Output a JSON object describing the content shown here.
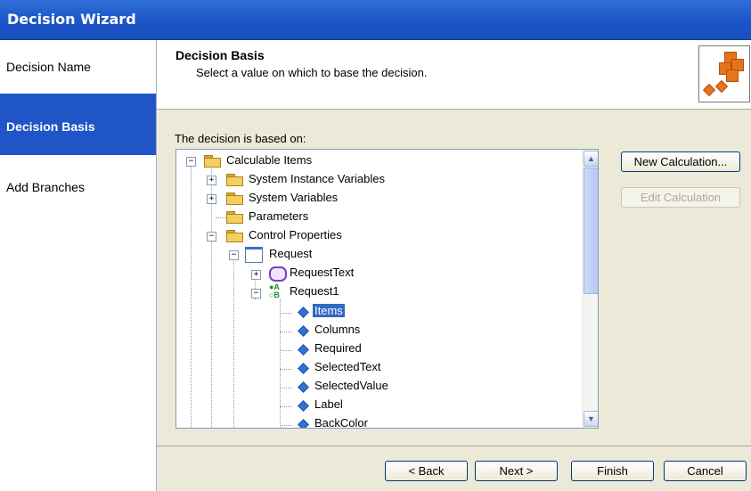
{
  "window": {
    "title": "Decision Wizard"
  },
  "nav": {
    "items": [
      {
        "label": "Decision Name",
        "active": false
      },
      {
        "label": "Decision Basis",
        "active": true
      },
      {
        "label": "Add Branches",
        "active": false
      }
    ]
  },
  "header": {
    "title": "Decision Basis",
    "subtitle": "Select a value on which to base the decision.",
    "icon": "cubes-icon"
  },
  "content": {
    "based_on_label": "The decision is based on:"
  },
  "tree": {
    "root": "Calculable Items",
    "system_instance": "System Instance Variables",
    "system_vars": "System Variables",
    "parameters": "Parameters",
    "control_props": "Control Properties",
    "request": "Request",
    "request_text": "RequestText",
    "request1": "Request1",
    "items": "Items",
    "columns": "Columns",
    "required": "Required",
    "selected_text": "SelectedText",
    "selected_value": "SelectedValue",
    "label": "Label",
    "back_color": "BackColor",
    "selected": "Items"
  },
  "buttons": {
    "new_calc": "New Calculation...",
    "edit_calc": "Edit Calculation",
    "back": "< Back",
    "next": "Next >",
    "finish": "Finish",
    "cancel": "Cancel"
  },
  "colors": {
    "title_bar": "#1c55c8",
    "nav_active": "#1f55c6",
    "selection": "#316ac5",
    "background": "#ece9d8"
  }
}
